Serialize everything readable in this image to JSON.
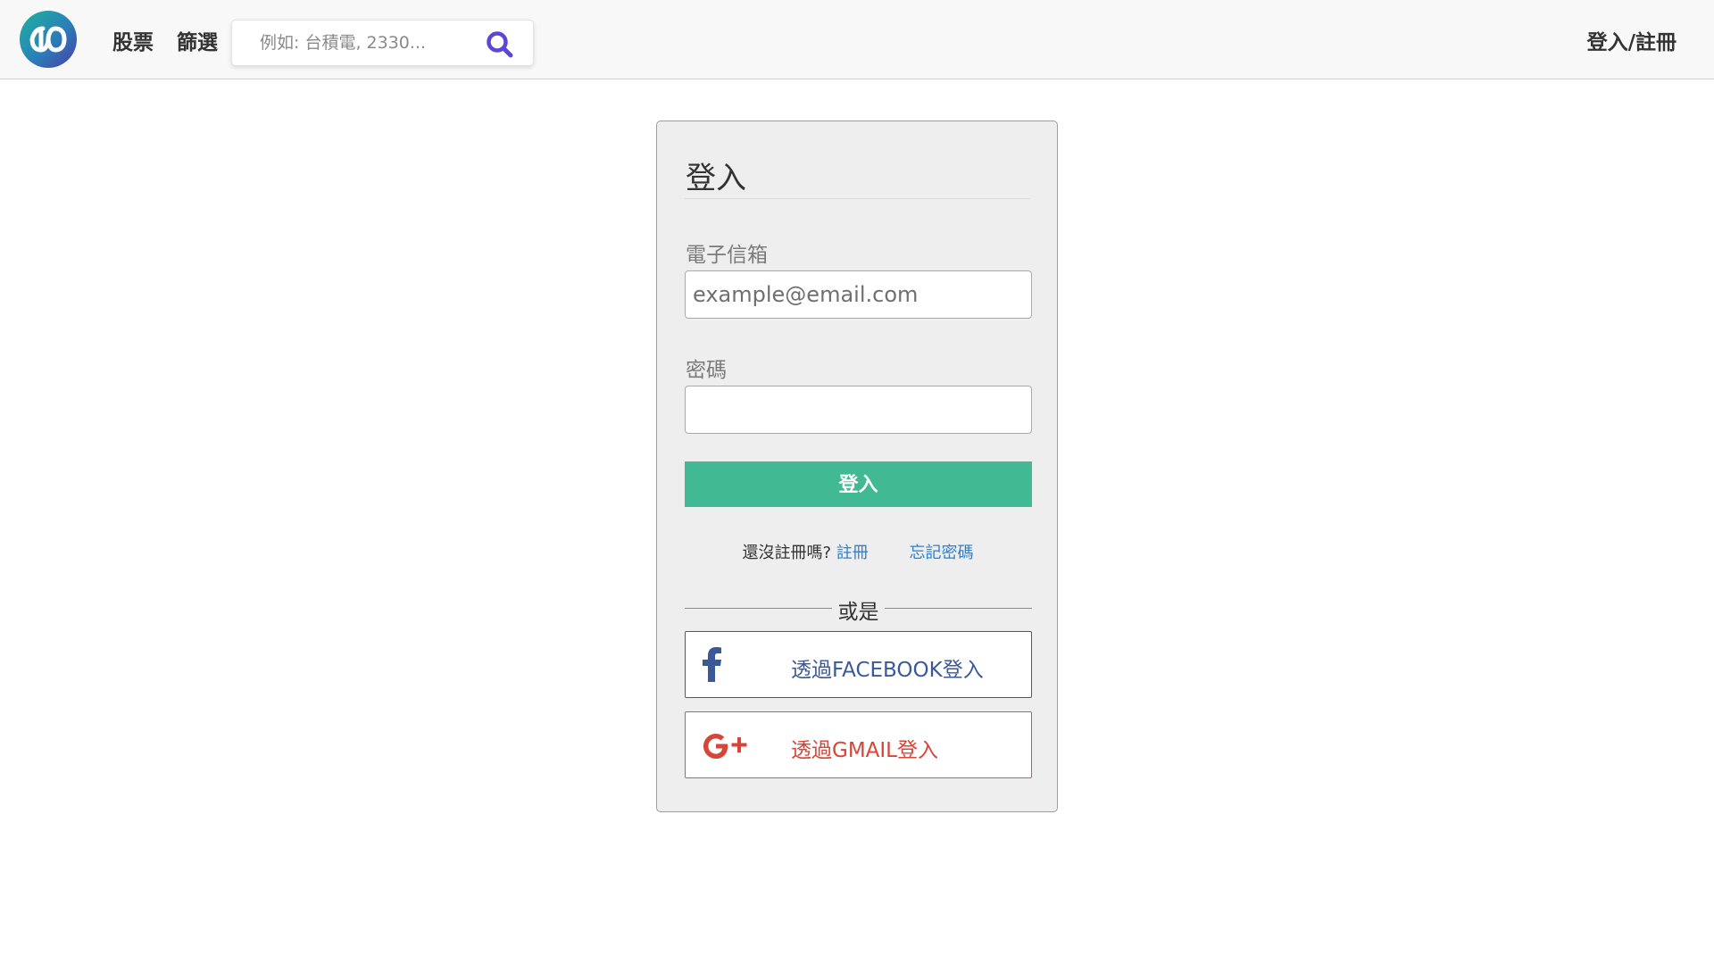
{
  "navbar": {
    "logo_icon": "double-loop-logo-icon",
    "links": {
      "stocks": "股票",
      "screener": "篩選"
    },
    "search": {
      "placeholder": "例如: 台積電, 2330...",
      "icon": "search-icon",
      "icon_color": "#5b47d6"
    },
    "login_register": "登入/註冊"
  },
  "login_card": {
    "title": "登入",
    "email": {
      "label": "電子信箱",
      "placeholder": "example@email.com",
      "value": ""
    },
    "password": {
      "label": "密碼",
      "value": ""
    },
    "submit_label": "登入",
    "no_account_text": "還沒註冊嗎?",
    "register_link": "註冊",
    "forgot_password_link": "忘記密碼",
    "or_text": "或是",
    "social": {
      "facebook": {
        "icon": "facebook-icon",
        "label": "透過FACEBOOK登入",
        "color": "#3b5998"
      },
      "gmail": {
        "icon": "google-plus-icon",
        "label": "透過GMAIL登入",
        "color": "#d64538"
      }
    }
  },
  "colors": {
    "accent_green": "#41b993",
    "link_blue": "#2f80d0",
    "card_background": "#eeeeee"
  }
}
